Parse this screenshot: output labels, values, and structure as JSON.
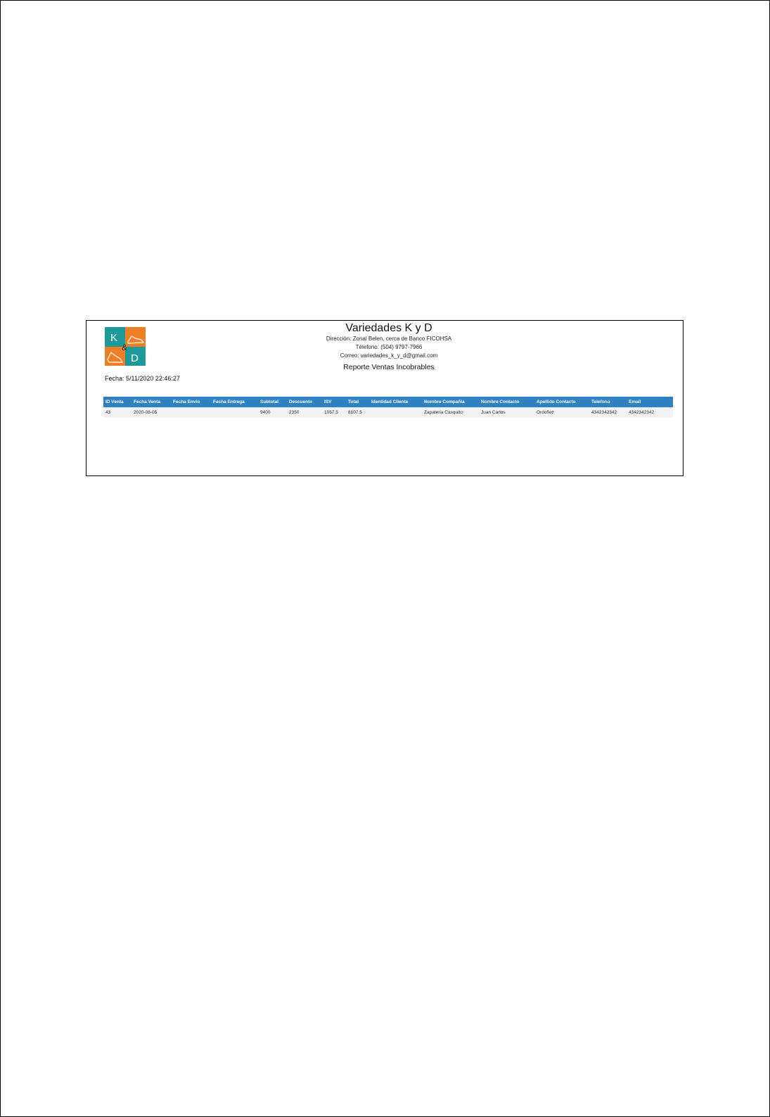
{
  "company": {
    "logo_icon": "kd-shoe-logo-icon",
    "logo_letters": [
      "K",
      "&",
      "D"
    ],
    "logo_colors": {
      "teal": "#1f9a9a",
      "orange": "#ef7f24"
    },
    "name": "Variedades K y D",
    "address": "Dirección: Zonal Belen, cerca de Banco FICOHSA",
    "phone": "Télefono: (504) 9797-7966",
    "email": "Correo: variedades_k_y_d@gmail.com"
  },
  "report": {
    "title": "Reporte Ventas Incobrables",
    "date": "Fecha: 5/11/2020 22:46:27"
  },
  "table": {
    "header_color": "#2e82c2",
    "columns": [
      "ID Venta",
      "Fecha Venta",
      "Fecha Envio",
      "Fecha Entrega",
      "Subtotal",
      "Descuento",
      "ISV",
      "Total",
      "Identidad Cliente",
      "Nombre Compañia",
      "Nombre Contacto",
      "Apellido Contacto",
      "Telefono",
      "Email"
    ],
    "rows": [
      [
        "43",
        "2020-08-05",
        "",
        "",
        "9400",
        "2350",
        "1057.5",
        "8107.5",
        "",
        "Zapateria Casquito",
        "Juan Carlos",
        "Ordoñez",
        "4342342342",
        "4342342342"
      ]
    ]
  }
}
